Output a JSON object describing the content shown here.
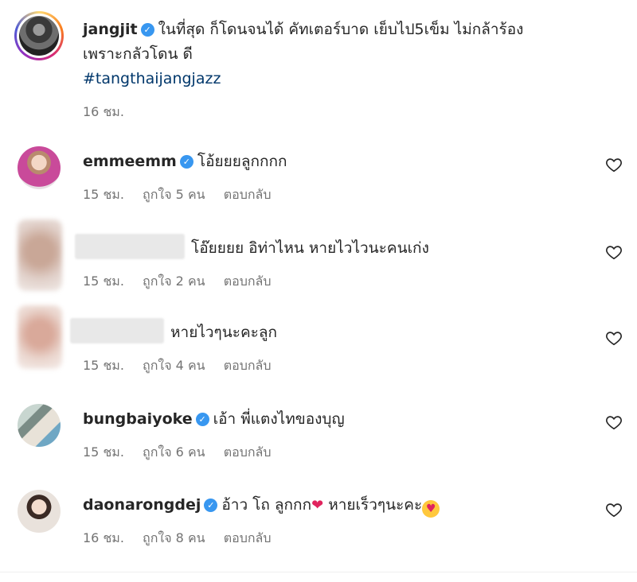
{
  "post": {
    "username": "jangjit",
    "text_line1": "ในที่สุด ก็โดนจนได้ คัทเตอร์บาด เย็บไป5เข็ม ไม่กล้าร้อง",
    "text_line2": "เพราะกลัวโดน ดี",
    "hashtag": "#tangthaijangjazz",
    "time": "16 ชม."
  },
  "comments": [
    {
      "username": "emmeemm",
      "verified": true,
      "text": "โอ้ยยยลูกกกก",
      "time": "15 ชม.",
      "likes": "ถูกใจ 5 คน",
      "reply": "ตอบกลับ"
    },
    {
      "username": "",
      "verified": false,
      "text": "โอ๊ยยยย อิท่าไหน หายไวไวนะคนเก่ง",
      "time": "15 ชม.",
      "likes": "ถูกใจ 2 คน",
      "reply": "ตอบกลับ"
    },
    {
      "username": "",
      "verified": false,
      "text": "หายไวๆนะคะลูก",
      "time": "15 ชม.",
      "likes": "ถูกใจ 4 คน",
      "reply": "ตอบกลับ"
    },
    {
      "username": "bungbaiyoke",
      "verified": true,
      "text": "เอ้า พี่แตงไทของบุญ",
      "time": "15 ชม.",
      "likes": "ถูกใจ 6 คน",
      "reply": "ตอบกลับ"
    },
    {
      "username": "daonarongdej",
      "verified": true,
      "text_a": "อ้าว โถ ลูกกก",
      "text_b": "หายเร็วๆนะคะ",
      "time": "16 ชม.",
      "likes": "ถูกใจ 8 คน",
      "reply": "ตอบกลับ"
    }
  ],
  "icons": {
    "verified": "verified-badge-icon",
    "heart": "heart-outline-icon"
  },
  "colors": {
    "verified": "#3897f0",
    "hashtag": "#00376b",
    "meta": "#737373"
  }
}
